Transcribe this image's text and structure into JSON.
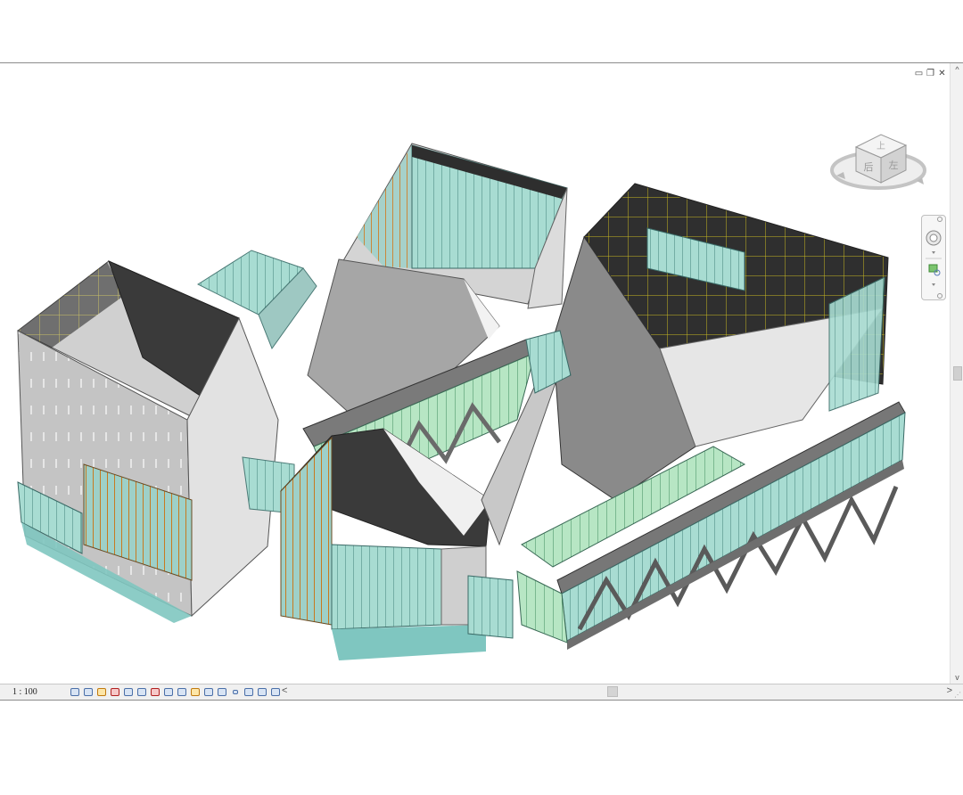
{
  "window": {
    "controls": [
      {
        "name": "minimize",
        "glyph": "▭"
      },
      {
        "name": "restore",
        "glyph": "❐"
      },
      {
        "name": "close",
        "glyph": "✕"
      }
    ]
  },
  "viewcube": {
    "faces": {
      "top": "上",
      "left": "后",
      "right": "左"
    }
  },
  "statusbar": {
    "scale": "1 : 100",
    "left_arrow": "<",
    "right_arrow": ">",
    "tools": [
      "detail-level",
      "visual-style",
      "sun-path",
      "shadows",
      "render",
      "crop-view",
      "show-crop",
      "unlock-3d",
      "temp-hide",
      "reveal-hidden",
      "temporary-properties",
      "analytical-model",
      "highlight-displacement",
      "worksharing",
      "design-options",
      "constraints"
    ]
  },
  "colors": {
    "glass": "#9ed6cc",
    "glass_dark": "#5fb0a8",
    "wall": "#b8b8b8",
    "wall_dark": "#3a3a3a",
    "roof_light": "#e8e8e8",
    "frame_yellow": "#d8c020",
    "mullion_orange": "#c87a20"
  }
}
